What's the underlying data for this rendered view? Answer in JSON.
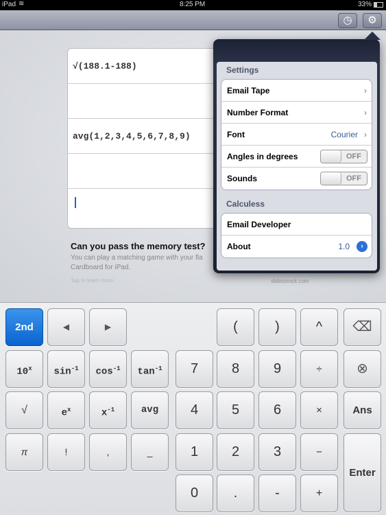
{
  "status": {
    "device": "iPad",
    "time": "8:25 PM",
    "battery": "33%"
  },
  "toolbar": {
    "history_icon": "clock-icon",
    "settings_icon": "gear-icon"
  },
  "tape": {
    "rows": [
      "√(188.1-188)",
      "",
      "avg(1,2,3,4,5,6,7,8,9)",
      "",
      ""
    ]
  },
  "ad": {
    "title": "Can you pass the memory test?",
    "body1": "You can play a matching game with your fla",
    "body2": "Cardboard for iPad.",
    "cta": "Tap to learn more.",
    "site": "slidetorock.com"
  },
  "settings": {
    "section1": "Settings",
    "email_tape": "Email Tape",
    "number_format": "Number Format",
    "font": "Font",
    "font_value": "Courier",
    "angles": "Angles in degrees",
    "angles_value": "OFF",
    "sounds": "Sounds",
    "sounds_value": "OFF",
    "section2": "Calculess",
    "email_dev": "Email Developer",
    "about": "About",
    "version": "1.0"
  },
  "keys": {
    "second": "2nd",
    "left": "◀",
    "right": "▶",
    "lparen": "(",
    "rparen": ")",
    "caret": "^",
    "backspace": "⌫",
    "pow10": "10",
    "pow10_sup": "x",
    "asin": "sin",
    "acos": "cos",
    "atan": "tan",
    "inv_sup": "-1",
    "seven": "7",
    "eight": "8",
    "nine": "9",
    "divide": "÷",
    "clear": "⊗",
    "sqrt": "√",
    "exp": "e",
    "exp_sup": "x",
    "recip": "x",
    "avg": "avg",
    "four": "4",
    "five": "5",
    "six": "6",
    "multiply": "×",
    "ans": "Ans",
    "pi": "π",
    "fact": "!",
    "comma": ",",
    "underscore": "_",
    "one": "1",
    "two": "2",
    "three": "3",
    "minus": "−",
    "enter": "Enter",
    "zero": "0",
    "dot": ".",
    "neg": "-",
    "plus": "+"
  }
}
